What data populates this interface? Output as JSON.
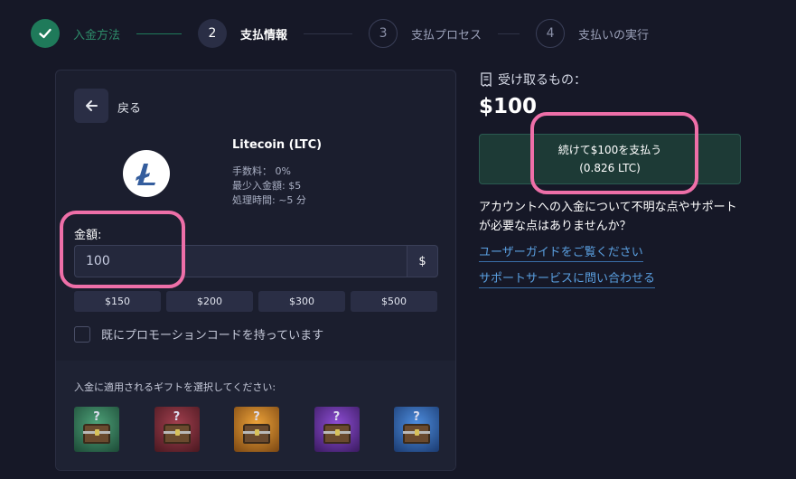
{
  "stepper": {
    "steps": [
      {
        "number": "",
        "label": "入金方法",
        "state": "done"
      },
      {
        "number": "2",
        "label": "支払情報",
        "state": "active"
      },
      {
        "number": "3",
        "label": "支払プロセス",
        "state": "pending"
      },
      {
        "number": "4",
        "label": "支払いの実行",
        "state": "pending"
      }
    ]
  },
  "card": {
    "back_label": "戻る",
    "coin": {
      "name": "Litecoin (LTC)",
      "fee": "手数料： 0%",
      "min_deposit": "最少入金額: $5",
      "processing_time": "処理時間: ~5 分"
    },
    "amount_label": "金額:",
    "amount_value": "100",
    "currency_symbol": "$",
    "presets": [
      "$150",
      "$200",
      "$300",
      "$500"
    ],
    "promo_label": "既にプロモーションコードを持っています",
    "gift_title": "入金に適用されるギフトを選択してください:",
    "gifts": [
      {
        "name": "green-gift",
        "color": "#2d6b4f"
      },
      {
        "name": "red-gift",
        "color": "#6b2530"
      },
      {
        "name": "orange-gift",
        "color": "#b5721e"
      },
      {
        "name": "purple-gift",
        "color": "#5a2a8a"
      },
      {
        "name": "blue-gift",
        "color": "#2a5a9a"
      }
    ],
    "gift_mark": "?"
  },
  "receive": {
    "title": "受け取るもの：",
    "amount": "$100",
    "continue_line1": "続けて$100を支払う",
    "continue_line2": "(0.826 LTC)",
    "help_text": "アカウントへの入金について不明な点やサポートが必要な点はありませんか？",
    "link_guide": "ユーザーガイドをご覧ください",
    "link_support": "サポートサービスに問い合わせる"
  },
  "colors": {
    "background": "#161827",
    "accent_green": "#1f7a5a",
    "highlight_pink": "#ee6fa8",
    "link_blue": "#5a9fe0"
  }
}
